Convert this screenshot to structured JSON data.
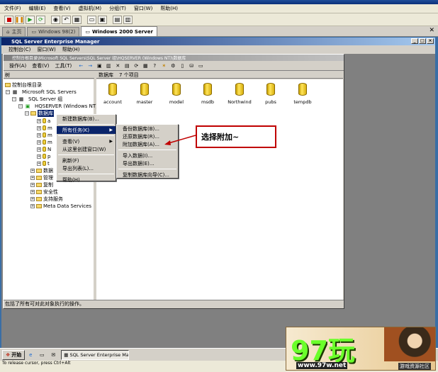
{
  "host": {
    "menu": [
      "文件(F)",
      "编辑(E)",
      "查看(V)",
      "虚拟机(M)",
      "分组(T)",
      "窗口(W)",
      "帮助(H)"
    ],
    "tabs": [
      {
        "label": "主页",
        "active": false
      },
      {
        "label": "Windows 98(2)",
        "active": false
      },
      {
        "label": "Windows 2000 Server",
        "active": true
      }
    ],
    "status_text": "To release cursor, press Ctrl+Alt"
  },
  "mmc": {
    "title": "SQL Server Enterprise Manager",
    "menu": [
      "控制台(C)",
      "窗口(W)",
      "帮助(H)"
    ]
  },
  "console": {
    "title": "控制台根目录\\Microsoft SQL Servers\\SQL Server 组\\HQSERVER (Windows NT)\\数据库",
    "toolbar_menu": [
      "操作(A)",
      "查看(V)",
      "工具(T)"
    ],
    "tree_header": "树",
    "list_header": {
      "label": "数据库",
      "count": "7 个项目"
    },
    "status": "包括了所有可对此对象执行的操作。"
  },
  "tree": {
    "root": "控制台根目录",
    "servers": "Microsoft SQL Servers",
    "group": "SQL Server 组",
    "server": "HQSERVER (Windows NT)",
    "databases": "数据库",
    "db_stubs": [
      "a",
      "m",
      "m",
      "m",
      "N",
      "p",
      "t"
    ],
    "partial_items": [
      "数据",
      "管理",
      "复制"
    ],
    "items": [
      "安全性",
      "支持服务",
      "Meta Data Services"
    ]
  },
  "databases": [
    "account",
    "master",
    "model",
    "msdb",
    "Northwind",
    "pubs",
    "tempdb"
  ],
  "context_menu": [
    "新建数据库(B)...",
    "所有任务(K)",
    "查看(V)",
    "从这里创建窗口(W)",
    "刷新(F)",
    "导出列表(L)...",
    "帮助(H)"
  ],
  "submenu": [
    "备份数据库(B)...",
    "还原数据库(R)...",
    "附加数据库(A)...",
    "导入数据(I)...",
    "导出数据(E)...",
    "复制数据库向导(C)..."
  ],
  "annotation": "选择附加~",
  "taskbar": {
    "start": "开始",
    "task": "SQL Server Enterprise Ma..."
  },
  "watermark": {
    "logo": "97玩",
    "url": "www.97w.net",
    "tag": "游戏资源社区"
  }
}
